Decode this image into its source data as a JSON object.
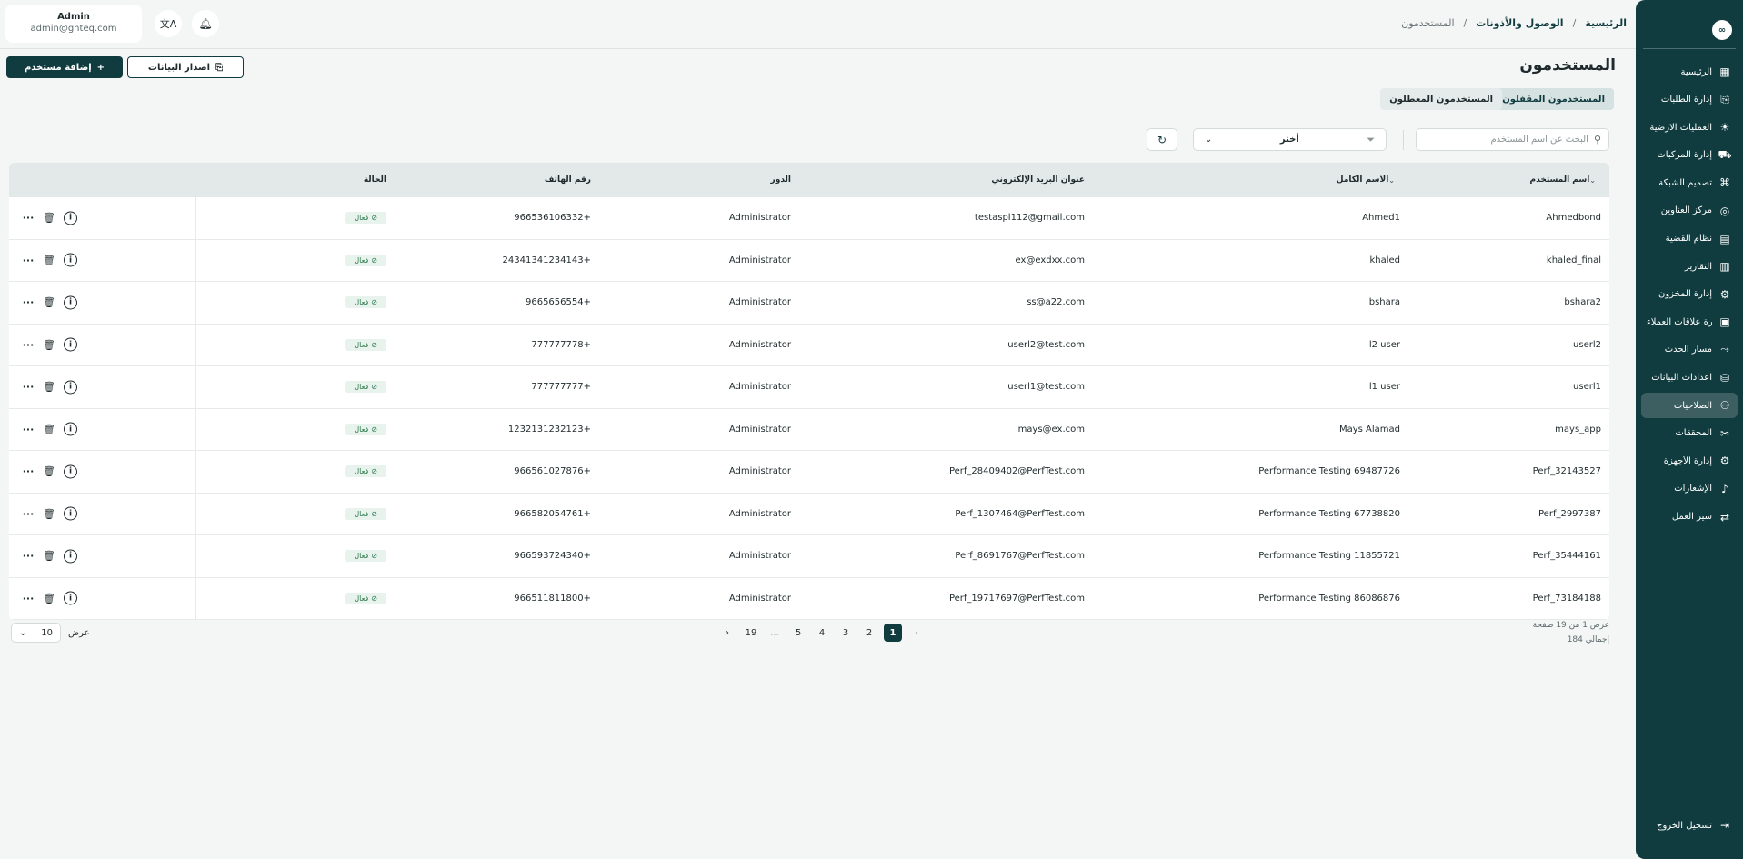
{
  "app": {
    "logo_text": "∞"
  },
  "sidebar": {
    "items": [
      {
        "label": "الرئيسية",
        "icon": "dashboard-icon",
        "glyph": "▦"
      },
      {
        "label": "إدارة الطلبات",
        "icon": "orders-icon",
        "glyph": "⎘"
      },
      {
        "label": "العمليات الارضية",
        "icon": "ground-ops-icon",
        "glyph": "☀"
      },
      {
        "label": "إدارة المركبات",
        "icon": "truck-icon",
        "glyph": "⛟"
      },
      {
        "label": "تصميم الشبكة",
        "icon": "network-icon",
        "glyph": "⌘"
      },
      {
        "label": "مركز العناوين",
        "icon": "location-icon",
        "glyph": "◎"
      },
      {
        "label": "نظام القضية",
        "icon": "case-icon",
        "glyph": "▤"
      },
      {
        "label": "التقارير",
        "icon": "reports-icon",
        "glyph": "▥"
      },
      {
        "label": "إدارة المخزون",
        "icon": "inventory-icon",
        "glyph": "⚙"
      },
      {
        "label": "إدارة علاقات العملاء",
        "icon": "crm-icon",
        "glyph": "▣"
      },
      {
        "label": "مسار الحدث",
        "icon": "route-icon",
        "glyph": "⤳"
      },
      {
        "label": "اعدادات البيانات",
        "icon": "database-icon",
        "glyph": "⛁"
      },
      {
        "label": "الصلاحيات",
        "icon": "users-icon",
        "glyph": "⚇",
        "active": true
      },
      {
        "label": "المحققات",
        "icon": "tools-icon",
        "glyph": "✂"
      },
      {
        "label": "إدارة الأجهزة",
        "icon": "device-icon",
        "glyph": "⚙"
      },
      {
        "label": "الإشعارات",
        "icon": "bell-icon",
        "glyph": "♪"
      },
      {
        "label": "سير العمل",
        "icon": "workflow-icon",
        "glyph": "⇄"
      }
    ],
    "logout_label": "تسجيل الخروج"
  },
  "header": {
    "breadcrumb": {
      "home": "الرئيسية",
      "section": "الوصول والأذونات",
      "current": "المستخدمون",
      "separator": "/"
    },
    "profile": {
      "name": "Admin",
      "email": "admin@gnteq.com"
    }
  },
  "page": {
    "title": "المستخدمون",
    "add_button": "إضافة مستخدم",
    "export_button": "اصدار البيانات",
    "tabs": [
      "المستخدمون المقفلون",
      "المستخدمون المعطلون"
    ],
    "search_placeholder": "البحث عن اسم المستخدم",
    "filter_value": "أختر"
  },
  "table": {
    "headers": {
      "username": "اسم المستخدم",
      "full_name": "الاسم الكامل",
      "email": "عنوان البريد الإلكتروني",
      "role": "الدور",
      "phone": "رقم الهاتف",
      "status": "الحالة"
    },
    "rows": [
      {
        "username": "Ahmedbond",
        "full_name": "Ahmed1",
        "email": "testaspl112@gmail.com",
        "role": "Administrator",
        "phone": "966536106332+",
        "status": "فعال"
      },
      {
        "username": "khaled_final",
        "full_name": "khaled",
        "email": "ex@exdxx.com",
        "role": "Administrator",
        "phone": "24341341234143+",
        "status": "فعال"
      },
      {
        "username": "bshara2",
        "full_name": "bshara",
        "email": "ss@a22.com",
        "role": "Administrator",
        "phone": "9665656554+",
        "status": "فعال"
      },
      {
        "username": "userl2",
        "full_name": "l2 user",
        "email": "userl2@test.com",
        "role": "Administrator",
        "phone": "777777778+",
        "status": "فعال"
      },
      {
        "username": "userl1",
        "full_name": "l1 user",
        "email": "userl1@test.com",
        "role": "Administrator",
        "phone": "777777777+",
        "status": "فعال"
      },
      {
        "username": "mays_app",
        "full_name": "Mays Alamad",
        "email": "mays@ex.com",
        "role": "Administrator",
        "phone": "1232131232123+",
        "status": "فعال"
      },
      {
        "username": "Perf_32143527",
        "full_name": "Performance Testing 69487726",
        "email": "Perf_28409402@PerfTest.com",
        "role": "Administrator",
        "phone": "966561027876+",
        "status": "فعال"
      },
      {
        "username": "Perf_2997387",
        "full_name": "Performance Testing 67738820",
        "email": "Perf_1307464@PerfTest.com",
        "role": "Administrator",
        "phone": "966582054761+",
        "status": "فعال"
      },
      {
        "username": "Perf_35444161",
        "full_name": "Performance Testing 11855721",
        "email": "Perf_8691767@PerfTest.com",
        "role": "Administrator",
        "phone": "966593724340+",
        "status": "فعال"
      },
      {
        "username": "Perf_73184188",
        "full_name": "Performance Testing 86086876",
        "email": "Perf_19717697@PerfTest.com",
        "role": "Administrator",
        "phone": "966511811800+",
        "status": "فعال"
      }
    ]
  },
  "pagination": {
    "info_line": "عرض 1 من 19 صفحة",
    "total_line": "إجمالي 184",
    "pages": [
      "1",
      "2",
      "3",
      "4",
      "5",
      "...",
      "19"
    ],
    "current": "1",
    "per_page_label": "عرض",
    "per_page_value": "10"
  },
  "colors": {
    "primary": "#103c3f",
    "active_badge_bg": "#e7f3ec",
    "active_badge_text": "#2f7a4f"
  }
}
